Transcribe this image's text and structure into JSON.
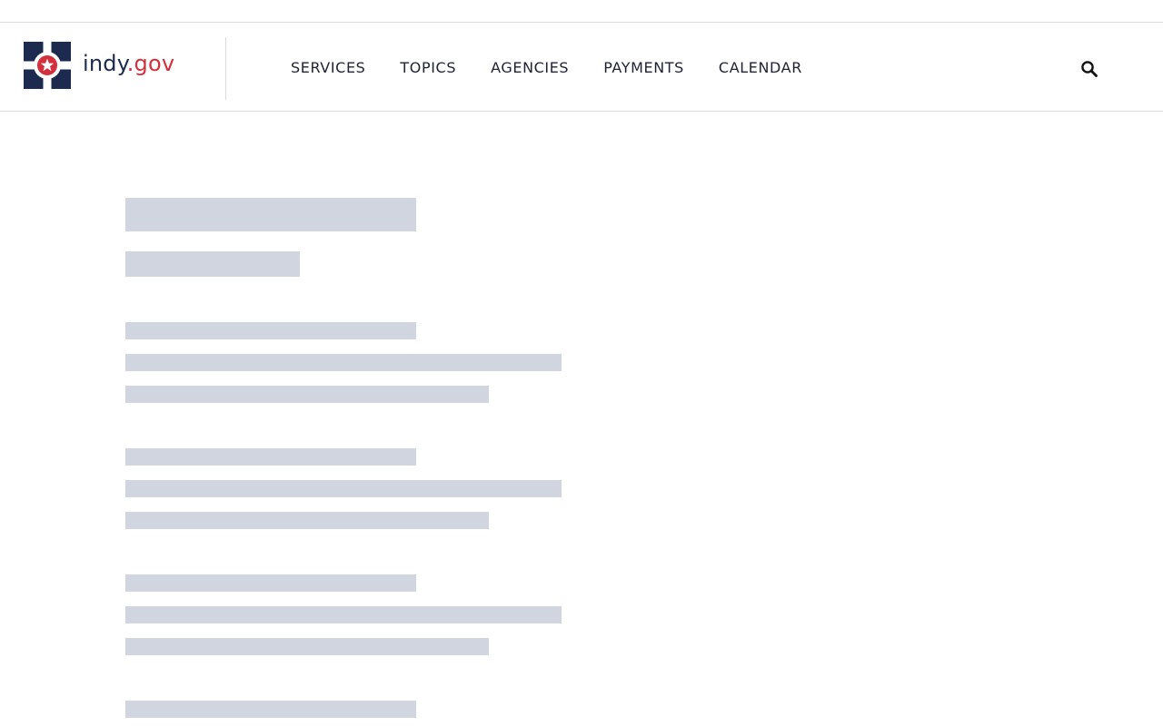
{
  "brand": {
    "name_main": "indy",
    "name_suffix": ".gov",
    "colors": {
      "navy": "#1c2a4f",
      "red": "#d32f3c",
      "skeleton": "#d0d5df"
    },
    "logo_icon": "indy-star-seal-icon"
  },
  "nav": {
    "items": [
      {
        "label": "SERVICES"
      },
      {
        "label": "TOPICS"
      },
      {
        "label": "AGENCIES"
      },
      {
        "label": "PAYMENTS"
      },
      {
        "label": "CALENDAR"
      }
    ],
    "search_icon": "search-icon"
  },
  "content": {
    "state": "loading"
  }
}
